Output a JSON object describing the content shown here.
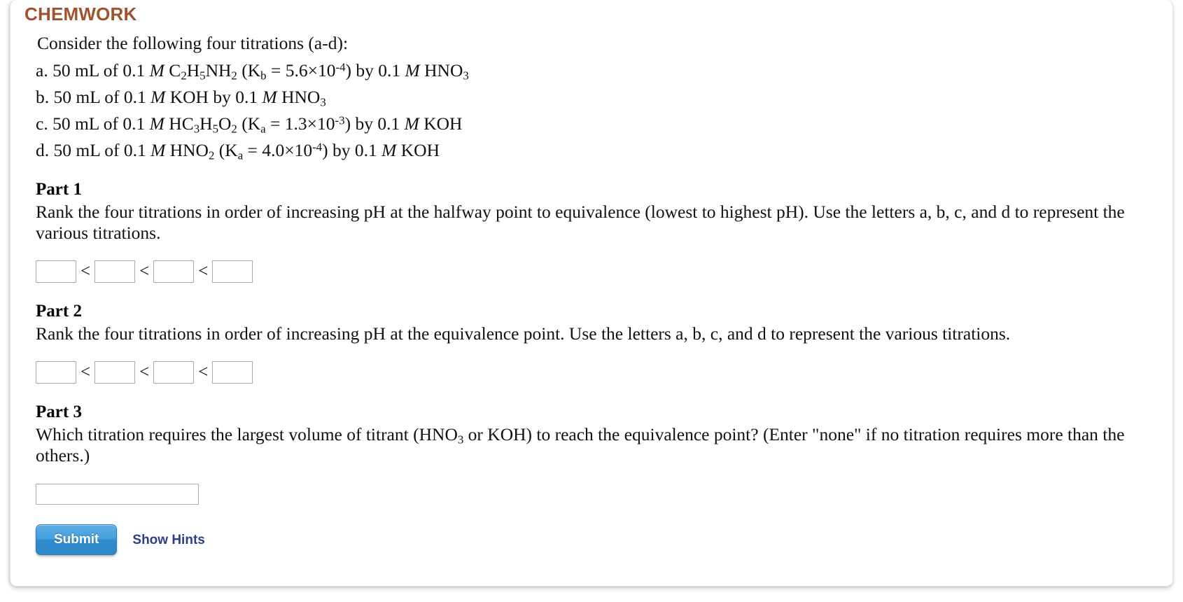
{
  "header": {
    "title": "CHEMWORK"
  },
  "intro": "Consider the following four titrations (a-d):",
  "titrations": [
    {
      "label": "a.",
      "text_plain": "a. 50 mL of 0.1 M C2H5NH2 (Kb = 5.6×10-4) by 0.1 M HNO3",
      "volume": "50 mL of 0.1",
      "molarity_symbol": "M",
      "analyte": "C2H5NH2",
      "constant_name": "Kb",
      "constant_value": "5.6×10",
      "constant_exponent": "-4",
      "titrant_conc": "by 0.1",
      "titrant": "HNO3"
    },
    {
      "label": "b.",
      "text_plain": "b. 50 mL of 0.1 M KOH by 0.1 M HNO3",
      "volume": "50 mL of 0.1",
      "molarity_symbol": "M",
      "analyte": "KOH",
      "constant_name": "",
      "constant_value": "",
      "constant_exponent": "",
      "titrant_conc": "by 0.1",
      "titrant": "HNO3"
    },
    {
      "label": "c.",
      "text_plain": "c. 50 mL of 0.1 M HC3H5O2 (Ka = 1.3×10-3) by 0.1 M KOH",
      "volume": "50 mL of 0.1",
      "molarity_symbol": "M",
      "analyte": "HC3H5O2",
      "constant_name": "Ka",
      "constant_value": "1.3×10",
      "constant_exponent": "-3",
      "titrant_conc": "by 0.1",
      "titrant": "KOH"
    },
    {
      "label": "d.",
      "text_plain": "d. 50 mL of 0.1 M HNO2 (Ka = 4.0×10-4) by 0.1 M KOH",
      "volume": "50 mL of 0.1",
      "molarity_symbol": "M",
      "analyte": "HNO2",
      "constant_name": "Ka",
      "constant_value": "4.0×10",
      "constant_exponent": "-4",
      "titrant_conc": "by 0.1",
      "titrant": "KOH"
    }
  ],
  "parts": [
    {
      "title": "Part 1",
      "prompt": "Rank the four titrations in order of increasing pH at the halfway point to equivalence (lowest to highest pH). Use the letters a, b, c, and d to represent the various titrations.",
      "answer_type": "ranking",
      "separator": "<",
      "inputs": [
        {
          "value": "",
          "placeholder": ""
        },
        {
          "value": "",
          "placeholder": ""
        },
        {
          "value": "",
          "placeholder": ""
        },
        {
          "value": "",
          "placeholder": ""
        }
      ]
    },
    {
      "title": "Part 2",
      "prompt": "Rank the four titrations in order of increasing pH at the equivalence point. Use the letters a, b, c, and d to represent the various titrations.",
      "answer_type": "ranking",
      "separator": "<",
      "inputs": [
        {
          "value": "",
          "placeholder": ""
        },
        {
          "value": "",
          "placeholder": ""
        },
        {
          "value": "",
          "placeholder": ""
        },
        {
          "value": "",
          "placeholder": ""
        }
      ]
    },
    {
      "title": "Part 3",
      "prompt_part1": "Which titration requires the largest volume of titrant (HNO",
      "prompt_sub": "3",
      "prompt_part2": " or KOH) to reach the equivalence point? (Enter \"none\" if no titration requires more than the others.)",
      "answer_type": "text",
      "input": {
        "value": "",
        "placeholder": ""
      }
    }
  ],
  "actions": {
    "submit_label": "Submit",
    "show_hints_label": "Show Hints"
  },
  "colors": {
    "chemwork_brown": "#a0522d",
    "submit_blue": "#2e8bcd",
    "hints_navy": "#2c3f8c",
    "input_border": "#a9a9a9"
  }
}
